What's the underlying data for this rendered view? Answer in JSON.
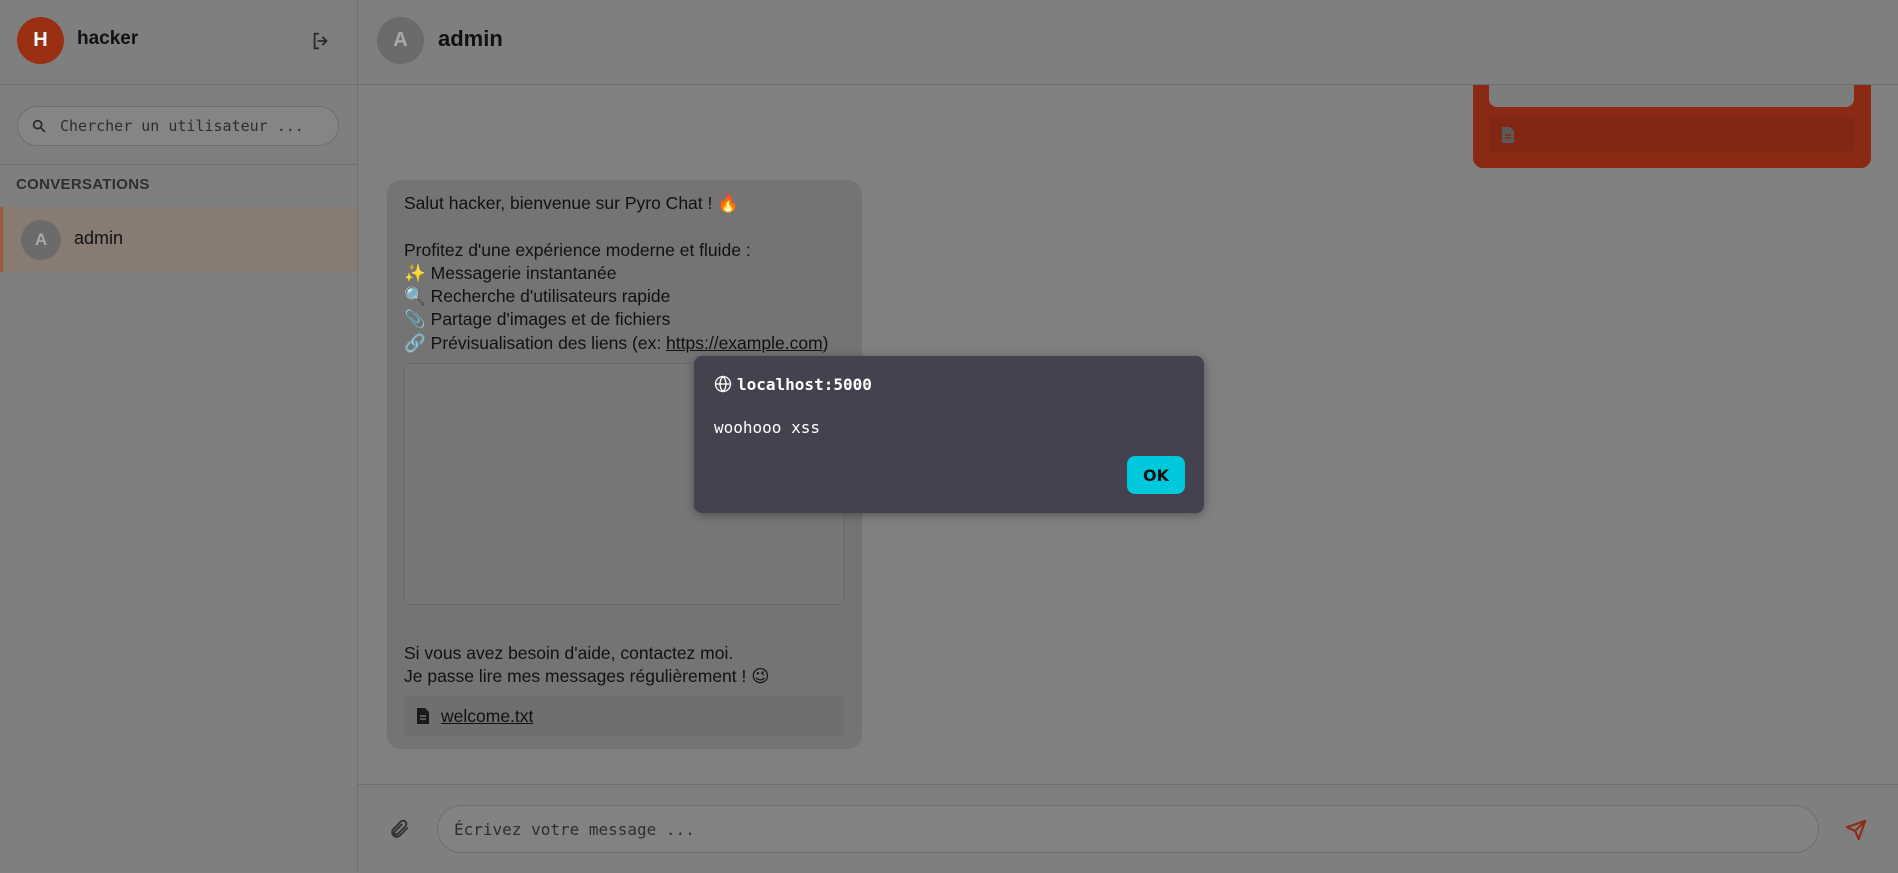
{
  "sidebar": {
    "user": {
      "avatar_letter": "H",
      "name": "hacker",
      "logout_icon": "logout-icon"
    },
    "search": {
      "placeholder": "Chercher un utilisateur ...",
      "value": ""
    },
    "section_title": "CONVERSATIONS",
    "conversations": [
      {
        "avatar_letter": "A",
        "name": "admin",
        "active": true
      }
    ]
  },
  "chat": {
    "header": {
      "avatar_letter": "A",
      "name": "admin"
    },
    "messages": {
      "incoming": {
        "text_before_link": "Salut hacker, bienvenue sur Pyro Chat ! 🔥\n\nProfitez d'une expérience moderne et fluide :\n✨ Messagerie instantanée\n🔍 Recherche d'utilisateurs rapide\n📎 Partage d'images et de fichiers\n🔗 Prévisualisation des liens (ex: ",
        "link": "https://example.com",
        "text_after_link": ")",
        "footer": "Si vous avez besoin d'aide, contactez moi.\nJe passe lire mes messages régulièrement ! 😉",
        "attachment_name": "welcome.txt"
      }
    },
    "composer": {
      "placeholder": "Écrivez votre message ...",
      "value": ""
    }
  },
  "alert": {
    "origin": "localhost:5000",
    "message": "woohooo xss",
    "ok_label": "OK"
  },
  "colors": {
    "accent": "#d9401c",
    "alert_bg": "#45424f",
    "ok_button": "#00c8dc"
  }
}
